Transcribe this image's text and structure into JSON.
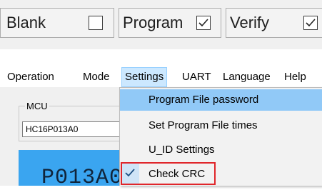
{
  "top_options": [
    {
      "label": "Blank",
      "checked": false
    },
    {
      "label": "Program",
      "checked": true
    },
    {
      "label": "Verify",
      "checked": true
    }
  ],
  "menubar": {
    "items": [
      "Operation",
      "Mode",
      "Settings",
      "UART",
      "Language",
      "Help"
    ],
    "active": "Settings"
  },
  "mcu": {
    "group_label": "MCU",
    "value": "HC16P013A0",
    "display_text": "P013A0"
  },
  "settings_menu": {
    "items": [
      {
        "label": "Program File password",
        "highlighted": true,
        "checked": false
      },
      {
        "label": "Set Program File times",
        "highlighted": false,
        "checked": false
      },
      {
        "label": "U_ID Settings",
        "highlighted": false,
        "checked": false
      },
      {
        "label": "Check CRC",
        "highlighted": false,
        "checked": true,
        "annotated": true
      }
    ]
  },
  "colors": {
    "highlight": "#91c9f7",
    "annotation": "#e0262b",
    "display_bg": "#3aa5f0"
  }
}
